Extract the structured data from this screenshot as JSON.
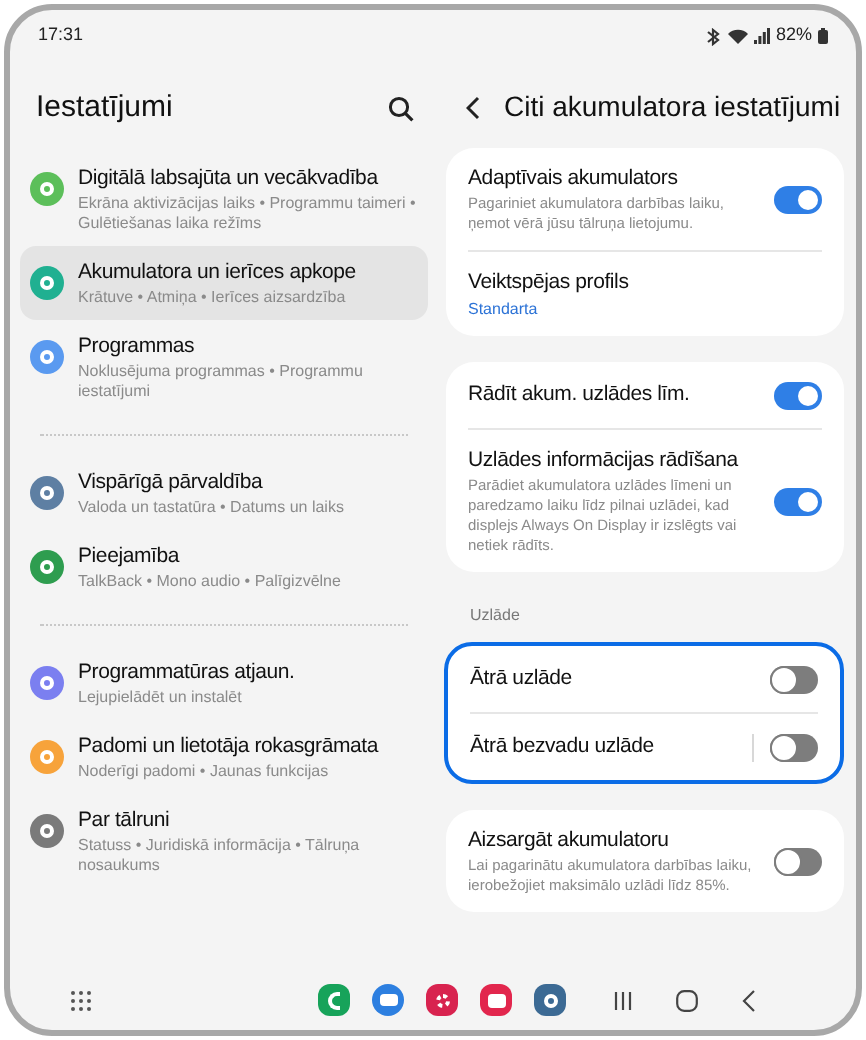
{
  "status_bar": {
    "time": "17:31",
    "battery": "82%"
  },
  "settings": {
    "title": "Iestatījumi",
    "groups": [
      [
        {
          "title": "Digitālā labsajūta un vecākvadība",
          "subtitle": "Ekrāna aktivizācijas laiks • Programmu taimeri • Gulētiešanas laika režīms",
          "color": "#5cbf5a",
          "selected": false
        },
        {
          "title": "Akumulatora un ierīces apkope",
          "subtitle": "Krātuve • Atmiņa • Ierīces aizsardzība",
          "color": "#20b091",
          "selected": true
        },
        {
          "title": "Programmas",
          "subtitle": "Noklusējuma programmas • Programmu iestatījumi",
          "color": "#5a9af0",
          "selected": false
        }
      ],
      [
        {
          "title": "Vispārīgā pārvaldība",
          "subtitle": "Valoda un tastatūra • Datums un laiks",
          "color": "#5e7fa3",
          "selected": false
        },
        {
          "title": "Pieejamība",
          "subtitle": "TalkBack • Mono audio • Palīgizvēlne",
          "color": "#2e9d4f",
          "selected": false
        }
      ],
      [
        {
          "title": "Programmatūras atjaun.",
          "subtitle": "Lejupielādēt un instalēt",
          "color": "#7b7ff0",
          "selected": false
        },
        {
          "title": "Padomi un lietotāja rokasgrāmata",
          "subtitle": "Noderīgi padomi • Jaunas funkcijas",
          "color": "#f7a33b",
          "selected": false
        },
        {
          "title": "Par tālruni",
          "subtitle": "Statuss • Juridiskā informācija • Tālruņa nosaukums",
          "color": "#7a7a7a",
          "selected": false
        }
      ]
    ]
  },
  "battery_settings": {
    "title": "Citi akumulatora iestatījumi",
    "sections": [
      {
        "highlighted": false,
        "rows": [
          {
            "kind": "toggle",
            "title": "Adaptīvais akumulators",
            "subtitle": "Pagariniet akumulatora darbības laiku, ņemot vērā jūsu tālruņa lietojumu.",
            "on": true
          },
          {
            "kind": "link",
            "title": "Veiktspējas profils",
            "value": "Standarta"
          }
        ]
      },
      {
        "highlighted": false,
        "rows": [
          {
            "kind": "toggle",
            "title": "Rādīt akum. uzlādes līm.",
            "on": true
          },
          {
            "kind": "toggle",
            "title": "Uzlādes informācijas rādīšana",
            "subtitle": "Parādiet akumulatora uzlādes līmeni un paredzamo laiku līdz pilnai uzlādei, kad displejs Always On Display ir izslēgts vai netiek rādīts.",
            "on": true
          }
        ]
      },
      {
        "header": "Uzlāde",
        "highlighted": true,
        "rows": [
          {
            "kind": "toggle",
            "title": "Ātrā uzlāde",
            "on": false
          },
          {
            "kind": "toggle",
            "title": "Ātrā bezvadu uzlāde",
            "on": false,
            "separator": true
          }
        ]
      },
      {
        "highlighted": false,
        "rows": [
          {
            "kind": "toggle",
            "title": "Aizsargāt akumulatoru",
            "subtitle": "Lai pagarinātu akumulatora darbības laiku, ierobežojiet maksimālo uzlādi līdz 85%.",
            "on": false
          }
        ]
      }
    ]
  }
}
